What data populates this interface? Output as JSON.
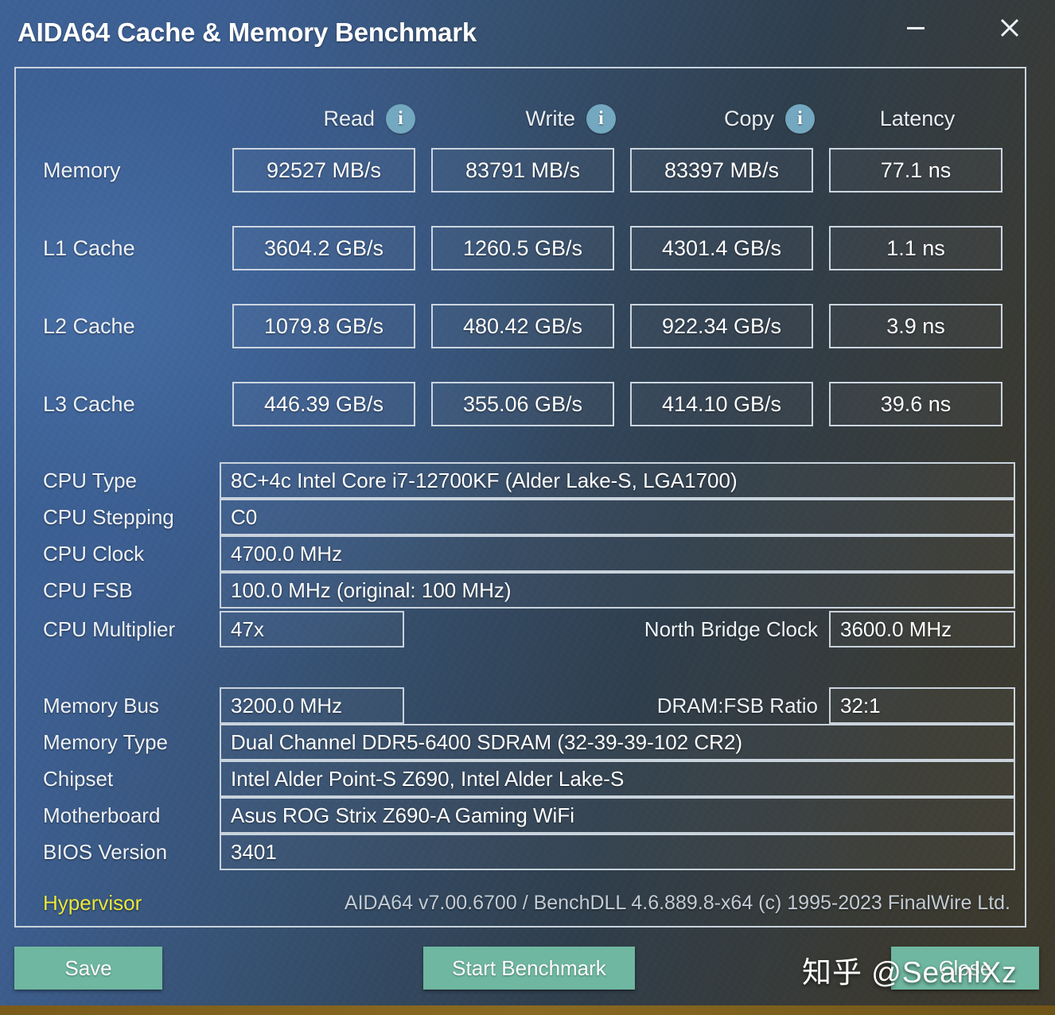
{
  "window": {
    "title": "AIDA64 Cache & Memory Benchmark",
    "minimize_icon": "minimize-icon",
    "close_icon": "close-icon"
  },
  "benchmark": {
    "columns": [
      "Read",
      "Write",
      "Copy",
      "Latency"
    ],
    "info_icon_label": "i",
    "rows": [
      {
        "label": "Memory",
        "read": "92527 MB/s",
        "write": "83791 MB/s",
        "copy": "83397 MB/s",
        "latency": "77.1 ns"
      },
      {
        "label": "L1 Cache",
        "read": "3604.2 GB/s",
        "write": "1260.5 GB/s",
        "copy": "4301.4 GB/s",
        "latency": "1.1 ns"
      },
      {
        "label": "L2 Cache",
        "read": "1079.8 GB/s",
        "write": "480.42 GB/s",
        "copy": "922.34 GB/s",
        "latency": "3.9 ns"
      },
      {
        "label": "L3 Cache",
        "read": "446.39 GB/s",
        "write": "355.06 GB/s",
        "copy": "414.10 GB/s",
        "latency": "39.6 ns"
      }
    ]
  },
  "cpu_info": {
    "type_label": "CPU Type",
    "type_value": "8C+4c Intel Core i7-12700KF  (Alder Lake-S, LGA1700)",
    "stepping_label": "CPU Stepping",
    "stepping_value": "C0",
    "clock_label": "CPU Clock",
    "clock_value": "4700.0 MHz",
    "fsb_label": "CPU FSB",
    "fsb_value": "100.0 MHz  (original: 100 MHz)",
    "multiplier_label": "CPU Multiplier",
    "multiplier_value": "47x",
    "north_bridge_label": "North Bridge Clock",
    "north_bridge_value": "3600.0 MHz"
  },
  "memory_info": {
    "bus_label": "Memory Bus",
    "bus_value": "3200.0 MHz",
    "ratio_label": "DRAM:FSB Ratio",
    "ratio_value": "32:1",
    "type_label": "Memory Type",
    "type_value": "Dual Channel DDR5-6400 SDRAM  (32-39-39-102 CR2)",
    "chipset_label": "Chipset",
    "chipset_value": "Intel Alder Point-S Z690, Intel Alder Lake-S",
    "motherboard_label": "Motherboard",
    "motherboard_value": "Asus ROG Strix Z690-A Gaming WiFi",
    "bios_label": "BIOS Version",
    "bios_value": "3401"
  },
  "footer": {
    "hypervisor_label": "Hypervisor",
    "version_text": "AIDA64 v7.00.6700 / BenchDLL 4.6.889.8-x64  (c) 1995-2023 FinalWire Ltd."
  },
  "buttons": {
    "save": "Save",
    "start_benchmark": "Start Benchmark",
    "close": "Close"
  },
  "watermark": {
    "text": "知乎 @SeanlXz"
  },
  "colors": {
    "accent_button": "#6fb7a0",
    "info_icon": "#74a8c0",
    "hypervisor_text": "#e9e73c",
    "panel_border": "#c9d3dc"
  }
}
